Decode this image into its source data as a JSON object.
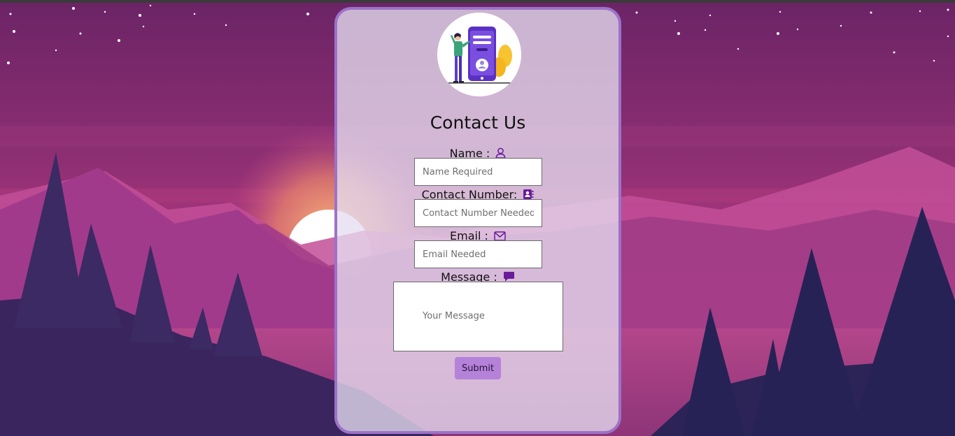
{
  "page": {
    "title": "Contact Us"
  },
  "form": {
    "name": {
      "label": "Name :",
      "placeholder": "Name Required",
      "icon": "user-outline-icon"
    },
    "contact": {
      "label": "Contact Number:",
      "placeholder": "Contact Number Needed",
      "icon": "address-book-icon"
    },
    "email": {
      "label": "Email :",
      "placeholder": "Email Needed",
      "icon": "envelope-icon"
    },
    "message": {
      "label": "Message :",
      "placeholder": "Your Message",
      "icon": "comment-icon"
    },
    "submit_label": "Submit"
  },
  "colors": {
    "card_border": "#9c72c9",
    "accent_purple": "#6a1b9a",
    "submit_bg": "#b582d9",
    "sky_top": "#6b2466",
    "sky_mid": "#b0387f",
    "sun_glow": "#f29c6b"
  }
}
